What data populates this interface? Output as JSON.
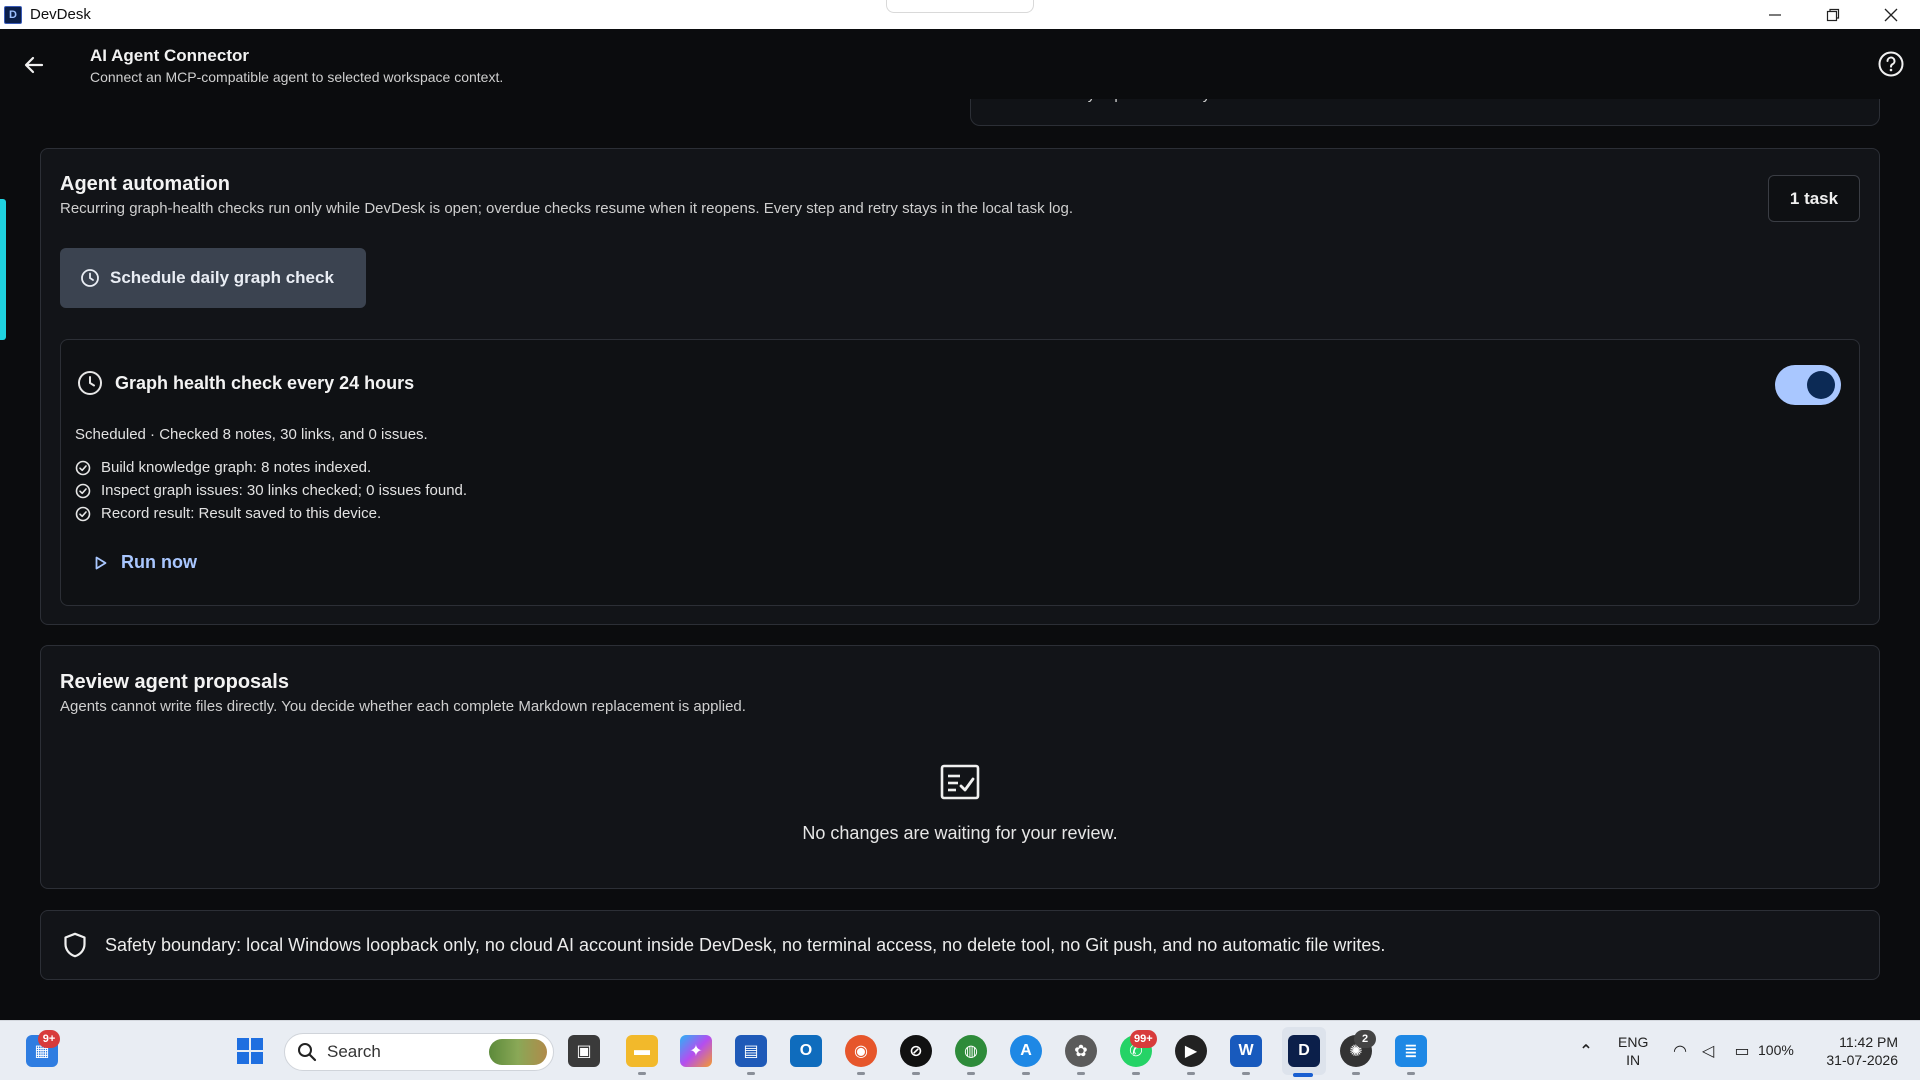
{
  "window": {
    "app_name": "DevDesk",
    "icon_letter": "D",
    "controls": [
      "minimize-icon",
      "restore-icon",
      "close-icon"
    ]
  },
  "header": {
    "title": "AI Agent Connector",
    "subtitle": "Connect an MCP-compatible agent to selected workspace context."
  },
  "previous_card": {
    "text": "The access key is protected for your Windows account."
  },
  "automation": {
    "title": "Agent automation",
    "description": "Recurring graph-health checks run only while DevDesk is open; overdue checks resume when it reopens. Every step and retry stays in the local task log.",
    "task_count": "1 task",
    "schedule_button": "Schedule daily graph check",
    "task": {
      "title": "Graph health check every 24 hours",
      "enabled": true,
      "status": "Scheduled · Checked 8 notes, 30 links, and 0 issues.",
      "steps": [
        "Build knowledge graph: 8 notes indexed.",
        "Inspect graph issues: 30 links checked; 0 issues found.",
        "Record result: Result saved to this device."
      ],
      "run_now": "Run now"
    }
  },
  "review": {
    "title": "Review agent proposals",
    "description": "Agents cannot write files directly. You decide whether each complete Markdown replacement is applied.",
    "empty_message": "No changes are waiting for your review."
  },
  "safety": {
    "text": "Safety boundary: local Windows loopback only, no cloud AI account inside DevDesk, no terminal access, no delete tool, no Git push, and no automatic file writes."
  },
  "taskbar": {
    "widgets_badge": "9+",
    "search_label": "Search",
    "whatsapp_badge": "99+",
    "chatgpt_badge": "2",
    "language": "ENG",
    "region": "IN",
    "battery": "100%",
    "time": "11:42 PM",
    "date": "31-07-2026"
  },
  "colors": {
    "accent": "#a9c7ff",
    "scroll_marker": "#1fd3e0",
    "card_bg": "#121418",
    "page_bg": "#0b0c0e"
  }
}
